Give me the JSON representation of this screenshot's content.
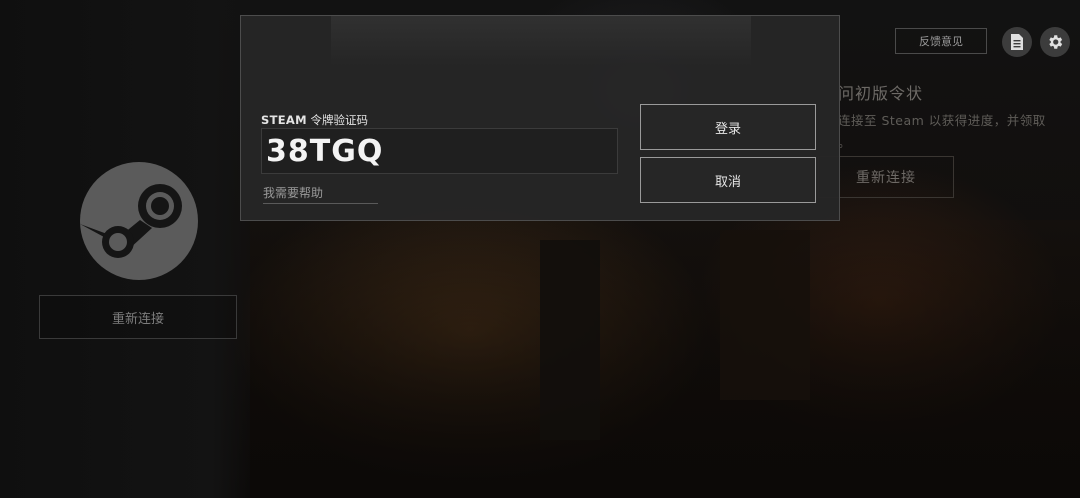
{
  "background": {
    "reconnect_left_label": "重新连接",
    "right_panel": {
      "title": "问初版令状",
      "description": "连接至 Steam 以获得进度，并领取",
      "description_cont": "。",
      "reconnect_label": "重新连接"
    }
  },
  "toolbar": {
    "feedback_label": "反馈意见",
    "icons": [
      "document-icon",
      "gear-icon"
    ]
  },
  "dialog": {
    "label_brand": "STEAM",
    "label_text": "令牌验证码",
    "code_value": "38TGQ",
    "help_link": "我需要帮助",
    "login_label": "登录",
    "cancel_label": "取消"
  },
  "colors": {
    "dialog_bg": "#262626",
    "button_border": "#9a9a9a",
    "page_bg": "#0d0b0a"
  }
}
